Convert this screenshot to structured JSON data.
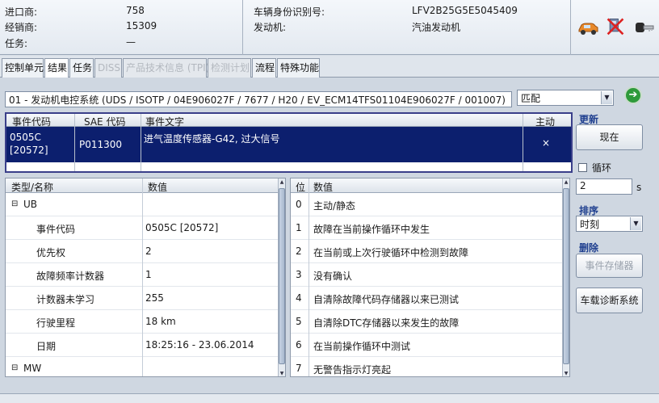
{
  "header": {
    "importer_label": "进口商:",
    "importer_value": "758",
    "dealer_label": "经销商:",
    "dealer_value": "15309",
    "task_label": "任务:",
    "task_value": "—",
    "vin_label": "车辆身份识别号:",
    "vin_value": "LFV2B25G5E5045409",
    "engine_label": "发动机:",
    "engine_value": "汽油发动机"
  },
  "tabs": [
    {
      "label": "控制单元",
      "state": "normal"
    },
    {
      "label": "结果",
      "state": "active"
    },
    {
      "label": "任务",
      "state": "normal"
    },
    {
      "label": "DISS",
      "state": "disabled"
    },
    {
      "label": "产品技术信息 (TPI)",
      "state": "disabled"
    },
    {
      "label": "检测计划",
      "state": "disabled"
    },
    {
      "label": "流程",
      "state": "normal"
    },
    {
      "label": "特殊功能",
      "state": "normal"
    }
  ],
  "control_unit_select": "01 - 发动机电控系统 (UDS / ISOTP / 04E906027F / 7677 / H20 / EV_ECM14TFS01104E906027F / 001007)",
  "match_select": "匹配",
  "event_table": {
    "headers": [
      "事件代码",
      "SAE 代码",
      "事件文字",
      "主动"
    ],
    "row": {
      "code_line1": "0505C",
      "code_line2": "[20572]",
      "sae": "P011300",
      "text": "进气温度传感器-G42, 过大信号",
      "active": "×"
    }
  },
  "side": {
    "update_label": "更新",
    "now_button": "现在",
    "loop_label": "循环",
    "interval_value": "2",
    "interval_unit": "s",
    "sort_label": "排序",
    "sort_value": "时刻",
    "delete_label": "删除",
    "event_memory_button": "事件存储器",
    "vehicle_diag_button": "车载诊断系统"
  },
  "detail_table": {
    "headers": [
      "类型/名称",
      "数值"
    ],
    "group1": "UB",
    "rows": [
      {
        "name": "事件代码",
        "value": "0505C [20572]"
      },
      {
        "name": "优先权",
        "value": "2"
      },
      {
        "name": "故障频率计数器",
        "value": "1"
      },
      {
        "name": "计数器未学习",
        "value": "255"
      },
      {
        "name": "行驶里程",
        "value": "18 km"
      },
      {
        "name": "日期",
        "value": "18:25:16 - 23.06.2014"
      }
    ],
    "group2": "MW"
  },
  "bits_table": {
    "headers": [
      "位",
      "数值"
    ],
    "rows": [
      {
        "bit": "0",
        "value": "主动/静态"
      },
      {
        "bit": "1",
        "value": "故障在当前操作循环中发生"
      },
      {
        "bit": "2",
        "value": "在当前或上次行驶循环中检测到故障"
      },
      {
        "bit": "3",
        "value": "没有确认"
      },
      {
        "bit": "4",
        "value": "自清除故障代码存储器以来已测试"
      },
      {
        "bit": "5",
        "value": "自清除DTC存储器以来发生的故障"
      },
      {
        "bit": "6",
        "value": "在当前操作循环中测试"
      },
      {
        "bit": "7",
        "value": "无警告指示灯亮起"
      }
    ]
  },
  "icons": [
    "car-icon",
    "disconnected-icon",
    "key-icon"
  ],
  "colors": {
    "selection": "#0c1f6e",
    "accent": "#1f3f8f",
    "go": "#2e9a3a"
  }
}
